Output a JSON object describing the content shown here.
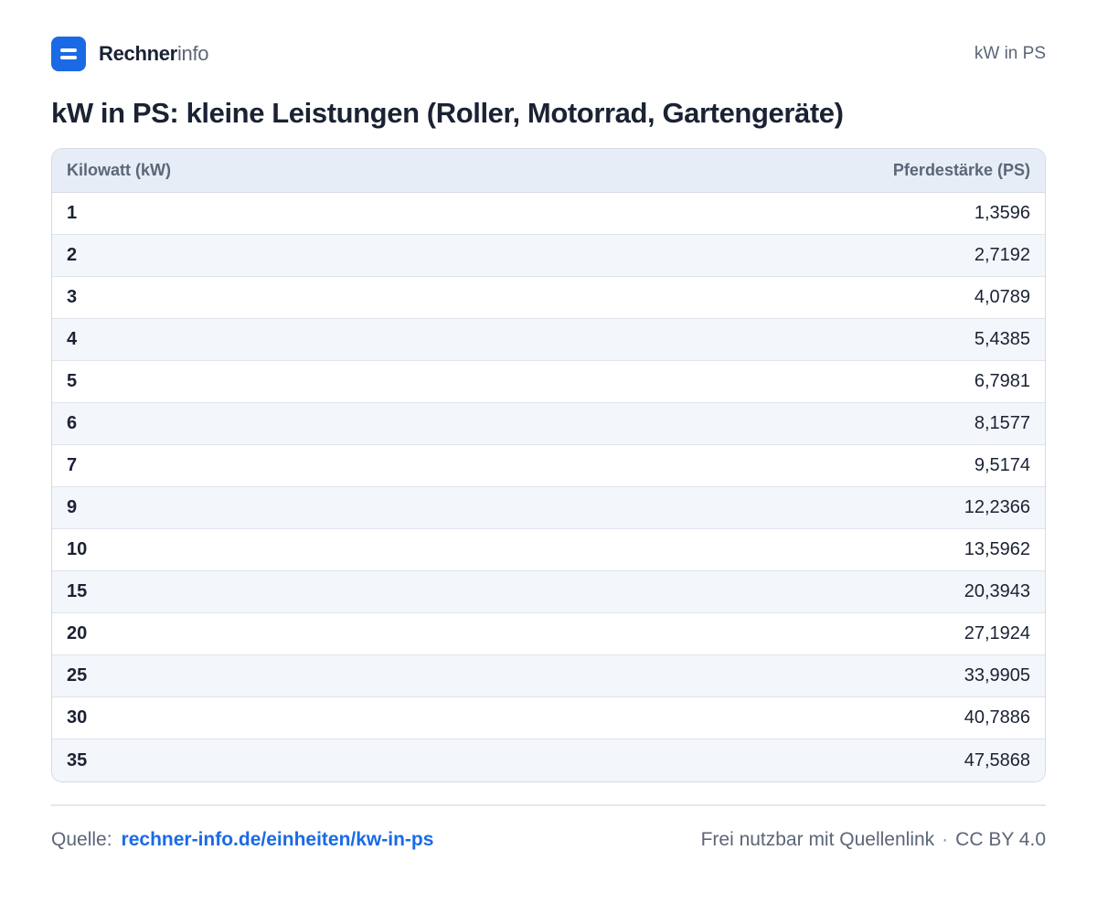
{
  "brand": {
    "name_strong": "Rechner",
    "name_light": "info"
  },
  "header": {
    "top_right": "kW in PS"
  },
  "page_title": "kW in PS: kleine Leistungen (Roller, Motorrad, Gartengeräte)",
  "table": {
    "columns": [
      "Kilowatt (kW)",
      "Pferdestärke (PS)"
    ],
    "rows": [
      {
        "kw": "1",
        "ps": "1,3596"
      },
      {
        "kw": "2",
        "ps": "2,7192"
      },
      {
        "kw": "3",
        "ps": "4,0789"
      },
      {
        "kw": "4",
        "ps": "5,4385"
      },
      {
        "kw": "5",
        "ps": "6,7981"
      },
      {
        "kw": "6",
        "ps": "8,1577"
      },
      {
        "kw": "7",
        "ps": "9,5174"
      },
      {
        "kw": "9",
        "ps": "12,2366"
      },
      {
        "kw": "10",
        "ps": "13,5962"
      },
      {
        "kw": "15",
        "ps": "20,3943"
      },
      {
        "kw": "20",
        "ps": "27,1924"
      },
      {
        "kw": "25",
        "ps": "33,9905"
      },
      {
        "kw": "30",
        "ps": "40,7886"
      },
      {
        "kw": "35",
        "ps": "47,5868"
      }
    ]
  },
  "footer": {
    "source_label": "Quelle:",
    "source_link": "rechner-info.de/einheiten/kw-in-ps",
    "usage_note": "Frei nutzbar mit Quellenlink",
    "separator": "·",
    "license": "CC BY 4.0"
  },
  "colors": {
    "accent": "#1a6ae6",
    "header_bg": "#e6edf6",
    "stripe_bg": "#f3f6fa"
  }
}
